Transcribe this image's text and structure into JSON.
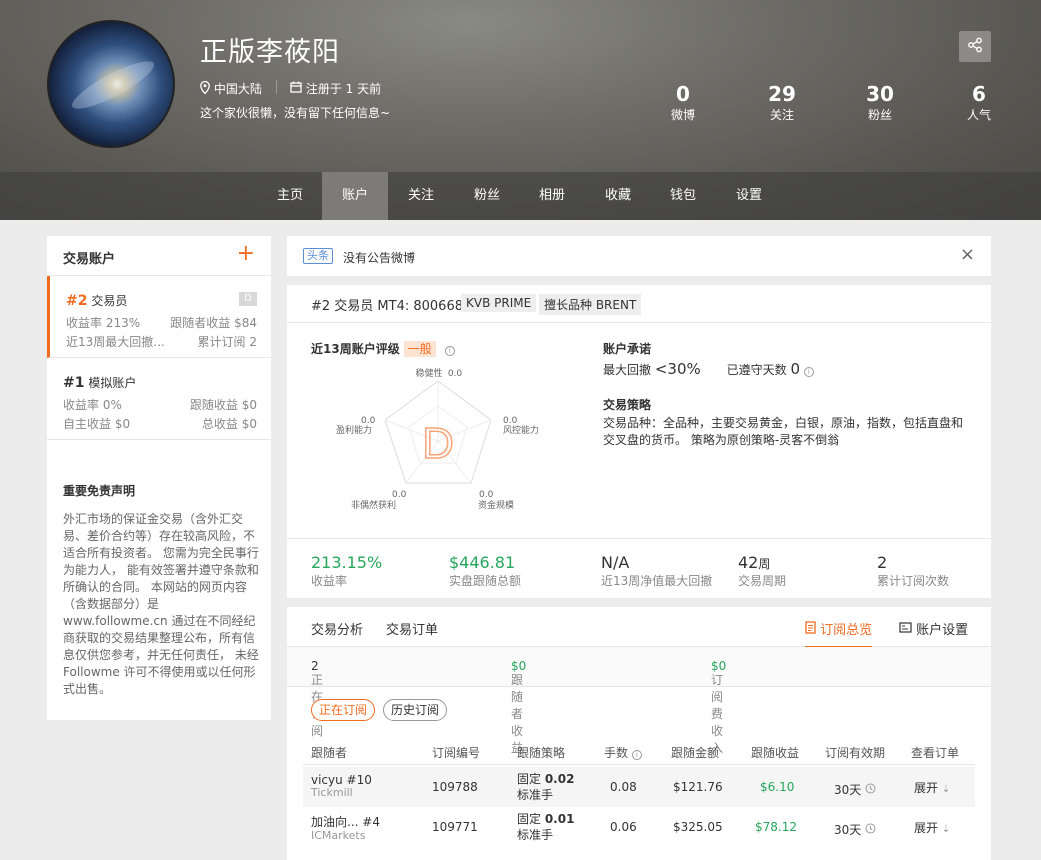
{
  "profile": {
    "name": "正版李莜阳",
    "location": "中国大陆",
    "registered": "注册于 1 天前",
    "bio": "这个家伙很懒，没有留下任何信息~",
    "stats": [
      {
        "value": "0",
        "label": "微博"
      },
      {
        "value": "29",
        "label": "关注"
      },
      {
        "value": "30",
        "label": "粉丝"
      },
      {
        "value": "6",
        "label": "人气"
      }
    ]
  },
  "nav": [
    "主页",
    "账户",
    "关注",
    "粉丝",
    "相册",
    "收藏",
    "钱包",
    "设置"
  ],
  "nav_active": "账户",
  "sidebar": {
    "title": "交易账户",
    "add_icon": "plus-icon",
    "accounts": [
      {
        "num": "#2",
        "name": "交易员",
        "badge": "D",
        "r1l": "收益率 213%",
        "r1r": "跟随者收益 $84",
        "r2l": "近13周最大回撤...",
        "r2r": "累计订阅 2"
      },
      {
        "num": "#1",
        "name": "模拟账户",
        "r1l": "收益率 0%",
        "r1r": "跟随收益 $0",
        "r2l": "自主收益 $0",
        "r2r": "总收益 $0"
      }
    ],
    "disclaimer_title": "重要免责声明",
    "disclaimer_body": "外汇市场的保证金交易（含外汇交易、差价合约等）存在较高风险，不适合所有投资者。 您需为完全民事行为能力人， 能有效签署并遵守条款和所确认的合同。 本网站的网页内容（含数据部分）是www.followme.cn 通过在不同经纪商获取的交易结果整理公布，所有信息仅供您参考，并无任何责任， 未经 Followme 许可不得使用或以任何形式出售。"
  },
  "announcement": {
    "tag": "头条",
    "text": "没有公告微博",
    "close": "×"
  },
  "account": {
    "title": "#2 交易员 MT4: 800668",
    "broker": "KVB PRIME",
    "specialty": "擅长品种 BRENT",
    "rating_title": "近13周账户评级",
    "rating_grade": "一般",
    "grade_letter": "D",
    "radar": [
      {
        "label": "稳健性",
        "value": "0.0"
      },
      {
        "label": "风控能力",
        "value": "0.0"
      },
      {
        "label": "资金规模",
        "value": "0.0"
      },
      {
        "label": "非偶然获利",
        "value": "0.0"
      },
      {
        "label": "盈利能力",
        "value": "0.0"
      }
    ],
    "commitment_title": "账户承诺",
    "max_drawdown_label": "最大回撤",
    "max_drawdown_value": "<30%",
    "days_label": "已遵守天数",
    "days_value": "0",
    "strategy_title": "交易策略",
    "strategy_text": "交易品种：全品种，主要交易黄金，白银，原油，指数，包括直盘和交叉盘的货币。 策略为原创策略-灵客不倒翁",
    "summary": [
      {
        "value": "213.15%",
        "label": "收益率",
        "color": "#26a65b"
      },
      {
        "value": "$446.81",
        "label": "实盘跟随总额",
        "color": "#26a65b"
      },
      {
        "value": "N/A",
        "label": "近13周净值最大回撤"
      },
      {
        "value": "42",
        "unit": "周",
        "label": "交易周期"
      },
      {
        "value": "2",
        "label": "累计订阅次数"
      }
    ]
  },
  "subscriptions": {
    "tabs": [
      "交易分析",
      "交易订单"
    ],
    "tab_overview": "订阅总览",
    "tab_settings": "账户设置",
    "stats": [
      {
        "label": "正在订阅",
        "value": "2"
      },
      {
        "label": "跟随者收益",
        "value": "$0"
      },
      {
        "label": "订阅费收入",
        "value": "$0"
      }
    ],
    "filters": [
      "正在订阅",
      "历史订阅"
    ],
    "columns": [
      "跟随者",
      "订阅编号",
      "跟随策略",
      "手数",
      "跟随金额",
      "跟随收益",
      "订阅有效期",
      "查看订单"
    ],
    "rows": [
      {
        "follower": "vicyu #10",
        "broker": "Tickmill",
        "id": "109788",
        "strategy_pre": "固定 ",
        "strategy_val": "0.02",
        "strategy_sub": "标准手",
        "lots": "0.08",
        "amount": "$121.76",
        "profit": "$6.10",
        "validity": "30天",
        "action": "展开"
      },
      {
        "follower": "加油向... #4",
        "broker": "ICMarkets",
        "id": "109771",
        "strategy_pre": "固定 ",
        "strategy_val": "0.01",
        "strategy_sub": "标准手",
        "lots": "0.06",
        "amount": "$325.05",
        "profit": "$78.12",
        "validity": "30天",
        "action": "展开"
      }
    ]
  },
  "colors": {
    "accent": "#f26b21",
    "positive": "#26a65b",
    "link": "#5a8fd8"
  }
}
